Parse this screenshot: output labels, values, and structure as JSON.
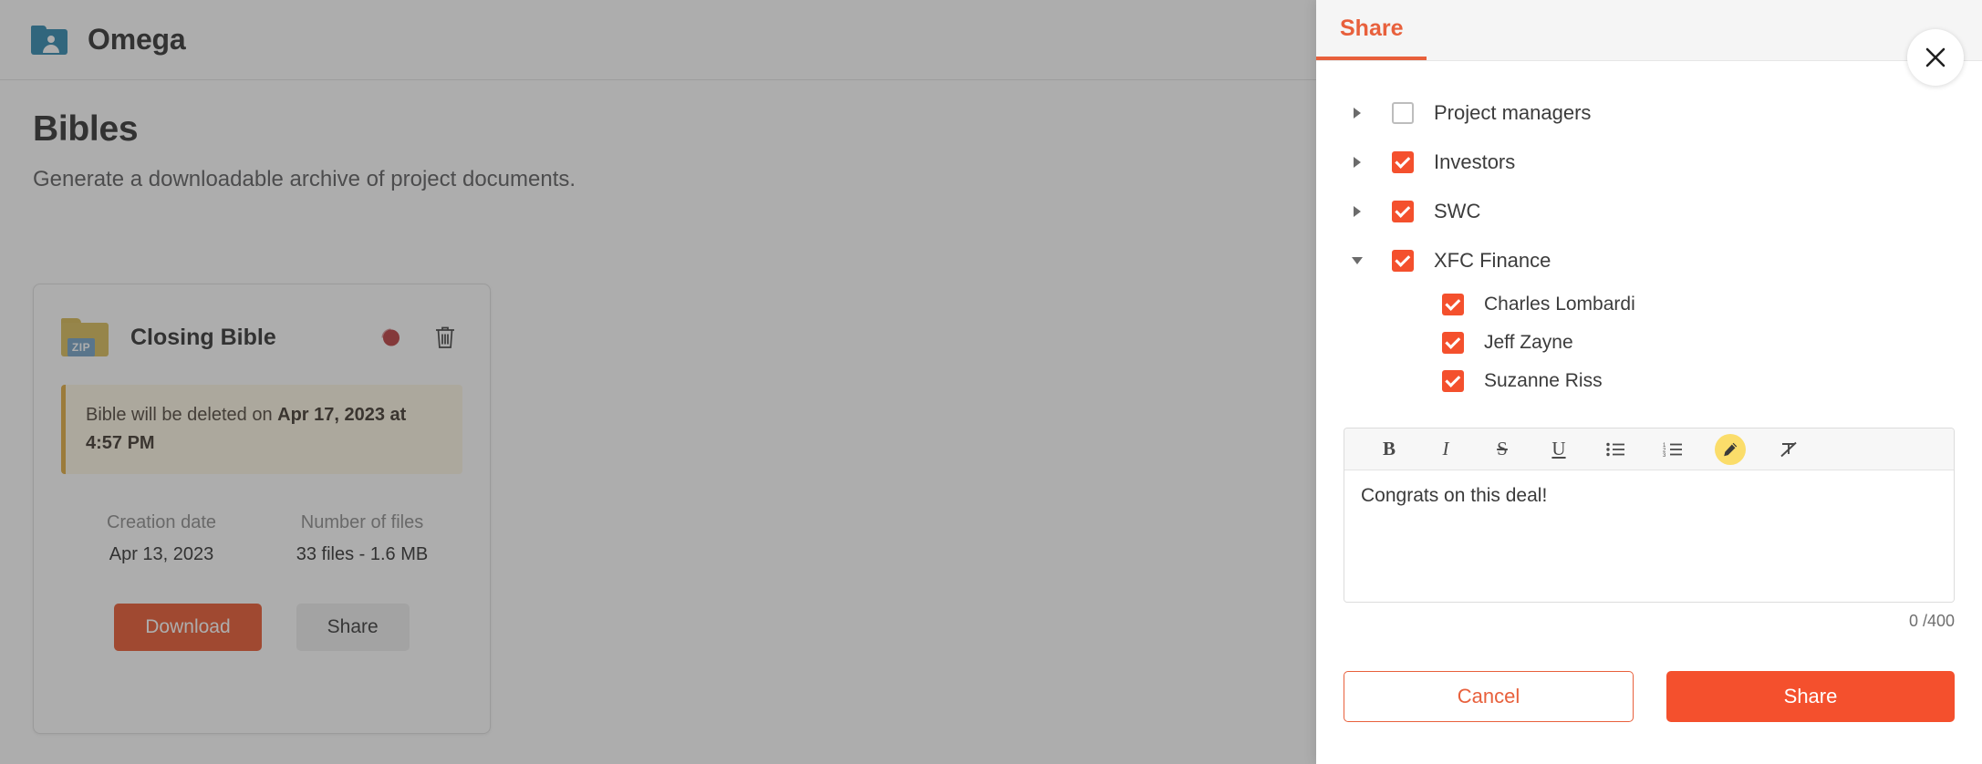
{
  "app": {
    "title": "Omega",
    "folder_icon": "folder-user-icon"
  },
  "page": {
    "title": "Bibles",
    "subtitle": "Generate a downloadable archive of project documents."
  },
  "bible_card": {
    "zip_badge": "ZIP",
    "name": "Closing Bible",
    "actions": {
      "regenerate_icon": "regenerate-icon",
      "delete_icon": "trash-icon"
    },
    "warning": {
      "prefix": "Bible will be deleted on ",
      "date": "Apr 17, 2023 at 4:57 PM"
    },
    "meta": [
      {
        "label": "Creation date",
        "value": "Apr 13, 2023"
      },
      {
        "label": "Number of files",
        "value": "33 files - 1.6 MB"
      }
    ],
    "download_label": "Download",
    "share_label": "Share"
  },
  "share_panel": {
    "tab_label": "Share",
    "close_icon": "close-icon",
    "tree": [
      {
        "label": "Project managers",
        "checked": false,
        "expanded": false,
        "level": 0
      },
      {
        "label": "Investors",
        "checked": true,
        "expanded": false,
        "level": 0
      },
      {
        "label": "SWC",
        "checked": true,
        "expanded": false,
        "level": 0
      },
      {
        "label": "XFC Finance",
        "checked": true,
        "expanded": true,
        "level": 0
      },
      {
        "label": "Charles Lombardi",
        "checked": true,
        "level": 1
      },
      {
        "label": "Jeff Zayne",
        "checked": true,
        "level": 1
      },
      {
        "label": "Suzanne Riss",
        "checked": true,
        "level": 1
      }
    ],
    "editor": {
      "toolbar": [
        {
          "icon": "bold-icon",
          "glyph": "B"
        },
        {
          "icon": "italic-icon",
          "glyph": "I"
        },
        {
          "icon": "strikethrough-icon",
          "glyph": "S"
        },
        {
          "icon": "underline-icon",
          "glyph": "U"
        },
        {
          "icon": "bulleted-list-icon",
          "glyph": ""
        },
        {
          "icon": "numbered-list-icon",
          "glyph": ""
        },
        {
          "icon": "highlighter-icon",
          "glyph": ""
        },
        {
          "icon": "clear-formatting-icon",
          "glyph": ""
        }
      ],
      "value": "Congrats on this deal!",
      "char_count": "0 /400"
    },
    "cancel_label": "Cancel",
    "share_label": "Share"
  },
  "colors": {
    "accent": "#e8603c",
    "checkbox": "#f4502d",
    "download": "#e8542a",
    "warning_border": "#e0a93b",
    "folder_blue": "#2a85ad",
    "zip_yellow": "#d8bb55",
    "highlighter": "#fbdd6a"
  }
}
